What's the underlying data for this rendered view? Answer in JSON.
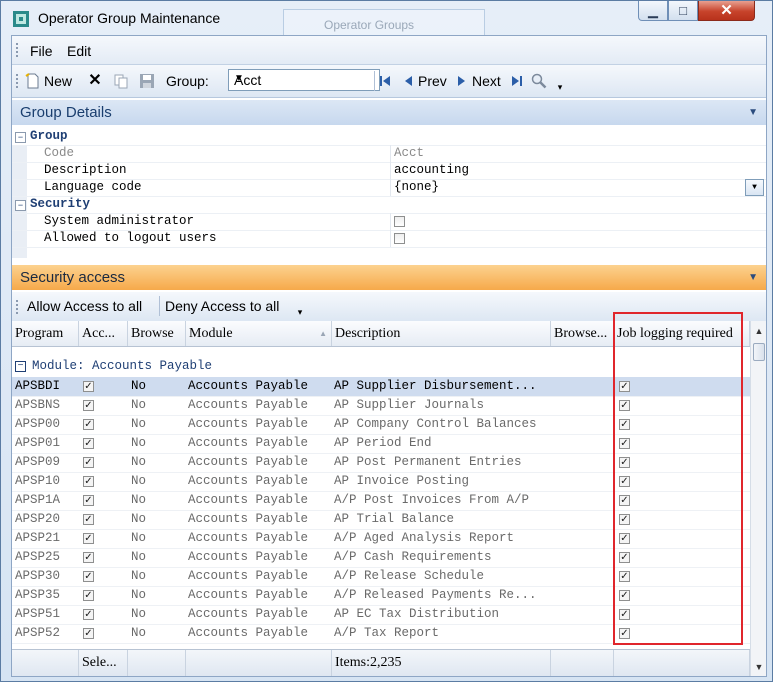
{
  "window": {
    "title": "Operator Group Maintenance",
    "ghost_title": "Operator Groups",
    "minimize_glyph": "▁",
    "maximize_glyph": "□",
    "close_glyph": "✕"
  },
  "menu": [
    "File",
    "Edit"
  ],
  "toolbar": {
    "new_label": "New",
    "group_label": "Group:",
    "group_value": "Acct",
    "prev_label": "Prev",
    "next_label": "Next"
  },
  "group_details": {
    "title": "Group Details",
    "group_category": "Group",
    "code_label": "Code",
    "code_value": "Acct",
    "description_label": "Description",
    "description_value": "accounting",
    "language_label": "Language code",
    "language_value": "{none}",
    "security_category": "Security",
    "sysadmin_label": "System administrator",
    "logout_label": "Allowed to logout users"
  },
  "security_access": {
    "title": "Security access",
    "allow_label": "Allow Access to all",
    "deny_label": "Deny Access to all"
  },
  "grid": {
    "headers": {
      "program": "Program",
      "access": "Acc...",
      "browse": "Browse",
      "module": "Module",
      "description": "Description",
      "browse2": "Browse...",
      "job_logging": "Job logging required"
    },
    "group_label": "Module: Accounts Payable",
    "rows": [
      {
        "program": "APSBDI",
        "browse": "No",
        "module": "Accounts Payable",
        "description": "AP Supplier Disbursement..."
      },
      {
        "program": "APSBNS",
        "browse": "No",
        "module": "Accounts Payable",
        "description": "AP Supplier Journals"
      },
      {
        "program": "APSP00",
        "browse": "No",
        "module": "Accounts Payable",
        "description": "AP Company Control Balances"
      },
      {
        "program": "APSP01",
        "browse": "No",
        "module": "Accounts Payable",
        "description": "AP Period End"
      },
      {
        "program": "APSP09",
        "browse": "No",
        "module": "Accounts Payable",
        "description": "AP Post Permanent Entries"
      },
      {
        "program": "APSP10",
        "browse": "No",
        "module": "Accounts Payable",
        "description": "AP Invoice Posting"
      },
      {
        "program": "APSP1A",
        "browse": "No",
        "module": "Accounts Payable",
        "description": "A/P Post Invoices From A/P"
      },
      {
        "program": "APSP20",
        "browse": "No",
        "module": "Accounts Payable",
        "description": "AP Trial Balance"
      },
      {
        "program": "APSP21",
        "browse": "No",
        "module": "Accounts Payable",
        "description": "A/P Aged Analysis Report"
      },
      {
        "program": "APSP25",
        "browse": "No",
        "module": "Accounts Payable",
        "description": "A/P Cash Requirements"
      },
      {
        "program": "APSP30",
        "browse": "No",
        "module": "Accounts Payable",
        "description": "A/P Release Schedule"
      },
      {
        "program": "APSP35",
        "browse": "No",
        "module": "Accounts Payable",
        "description": "A/P Released Payments Re..."
      },
      {
        "program": "APSP51",
        "browse": "No",
        "module": "Accounts Payable",
        "description": "AP EC Tax Distribution"
      },
      {
        "program": "APSP52",
        "browse": "No",
        "module": "Accounts Payable",
        "description": "A/P Tax Report"
      }
    ],
    "footer": {
      "selected": "Sele...",
      "items": "Items:2,235"
    }
  },
  "colors": {
    "highlight_box": "#e0262c",
    "selected_row": "#cfdcef",
    "orange_header": "#f6a94a"
  }
}
